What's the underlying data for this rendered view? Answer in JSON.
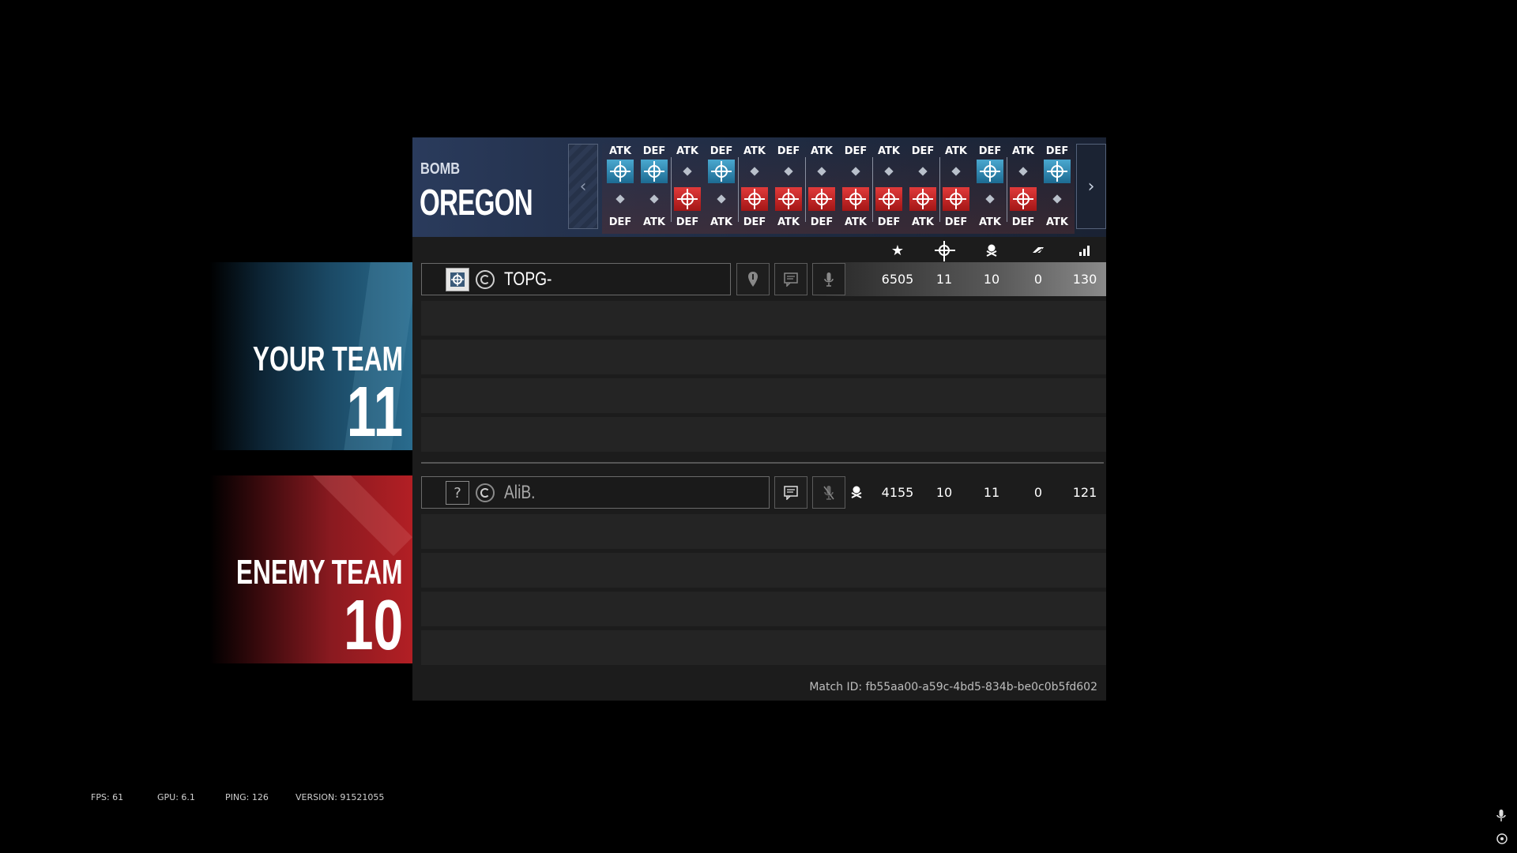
{
  "header": {
    "mode": "BOMB",
    "map": "OREGON"
  },
  "rounds": [
    {
      "top_label": "ATK",
      "bottom_label": "DEF",
      "top": "win",
      "bottom": "none"
    },
    {
      "top_label": "DEF",
      "bottom_label": "ATK",
      "top": "win",
      "bottom": "none"
    },
    {
      "top_label": "ATK",
      "bottom_label": "DEF",
      "top": "none",
      "bottom": "win"
    },
    {
      "top_label": "DEF",
      "bottom_label": "ATK",
      "top": "win",
      "bottom": "none"
    },
    {
      "top_label": "ATK",
      "bottom_label": "DEF",
      "top": "none",
      "bottom": "win"
    },
    {
      "top_label": "DEF",
      "bottom_label": "ATK",
      "top": "none",
      "bottom": "win"
    },
    {
      "top_label": "ATK",
      "bottom_label": "DEF",
      "top": "none",
      "bottom": "win"
    },
    {
      "top_label": "DEF",
      "bottom_label": "ATK",
      "top": "none",
      "bottom": "win"
    },
    {
      "top_label": "ATK",
      "bottom_label": "DEF",
      "top": "none",
      "bottom": "win"
    },
    {
      "top_label": "DEF",
      "bottom_label": "ATK",
      "top": "none",
      "bottom": "win"
    },
    {
      "top_label": "ATK",
      "bottom_label": "DEF",
      "top": "none",
      "bottom": "win"
    },
    {
      "top_label": "DEF",
      "bottom_label": "ATK",
      "top": "win",
      "bottom": "none"
    },
    {
      "top_label": "ATK",
      "bottom_label": "DEF",
      "top": "none",
      "bottom": "win"
    },
    {
      "top_label": "DEF",
      "bottom_label": "ATK",
      "top": "win",
      "bottom": "none"
    }
  ],
  "stat_headers": [
    "star-icon",
    "crosshair-icon",
    "skull-icon",
    "assist-icon",
    "signal-icon"
  ],
  "your_team": {
    "label": "YOUR TEAM",
    "score": "11",
    "player": {
      "name": "TOPG-",
      "score": "6505",
      "kills": "11",
      "deaths": "10",
      "assists": "0",
      "ping": "130"
    }
  },
  "enemy_team": {
    "label": "ENEMY TEAM",
    "score": "10",
    "player": {
      "name": "AliB.",
      "score": "4155",
      "kills": "10",
      "deaths": "11",
      "assists": "0",
      "ping": "121"
    }
  },
  "match_id": "Match ID: fb55aa00-a59c-4bd5-834b-be0c0b5fd602",
  "perf": {
    "fps": "FPS: 61",
    "gpu": "GPU: 6.1",
    "ping": "PING: 126",
    "version": "VERSION: 91521055"
  },
  "colors": {
    "win_blue": "#2f8fbf",
    "win_red": "#c62024",
    "panel": "#1c1c1c"
  }
}
